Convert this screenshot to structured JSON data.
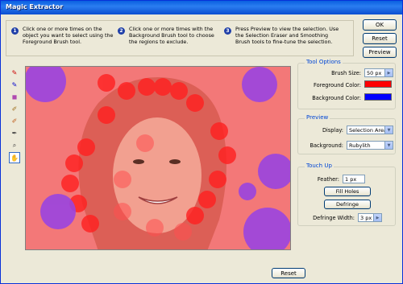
{
  "window": {
    "title": "Magic Extractor"
  },
  "instructions": [
    {
      "num": "1",
      "lines": [
        "Click one or more times on the",
        "object you want to select using the",
        "Foreground Brush tool."
      ]
    },
    {
      "num": "2",
      "lines": [
        "Click one or more times with the",
        "Background Brush tool to choose",
        "the regions to exclude."
      ]
    },
    {
      "num": "3",
      "lines": [
        "Press Preview to view the selection. Use",
        "the Selection Eraser and Smoothing",
        "Brush tools to fine-tune the selection."
      ]
    }
  ],
  "buttons": {
    "ok": "OK",
    "reset_top": "Reset",
    "preview": "Preview",
    "reset_bottom": "Reset"
  },
  "tools": [
    "foreground-brush",
    "background-brush",
    "point-eraser",
    "add-to-selection-brush",
    "remove-from-selection-brush",
    "smoothing-brush",
    "zoom",
    "hand"
  ],
  "tool_options": {
    "title": "Tool Options",
    "brush_size_label": "Brush Size:",
    "brush_size_value": "50 px",
    "fg_label": "Foreground Color:",
    "fg_color": "#ff0000",
    "bg_label": "Background Color:",
    "bg_color": "#0000ff"
  },
  "preview_group": {
    "title": "Preview",
    "display_label": "Display:",
    "display_value": "Selection Area",
    "background_label": "Background:",
    "background_value": "Rubylith"
  },
  "touch_up": {
    "title": "Touch Up",
    "feather_label": "Feather:",
    "feather_value": "1 px",
    "fill_holes": "Fill Holes",
    "defringe": "Defringe",
    "defringe_width_label": "Defringe Width:",
    "defringe_width_value": "3 px"
  },
  "colors": {
    "rubylith": "#f37878",
    "red_marks": "#ff2020",
    "blue_marks": "#9a44e0",
    "accent": "#0046d5"
  }
}
